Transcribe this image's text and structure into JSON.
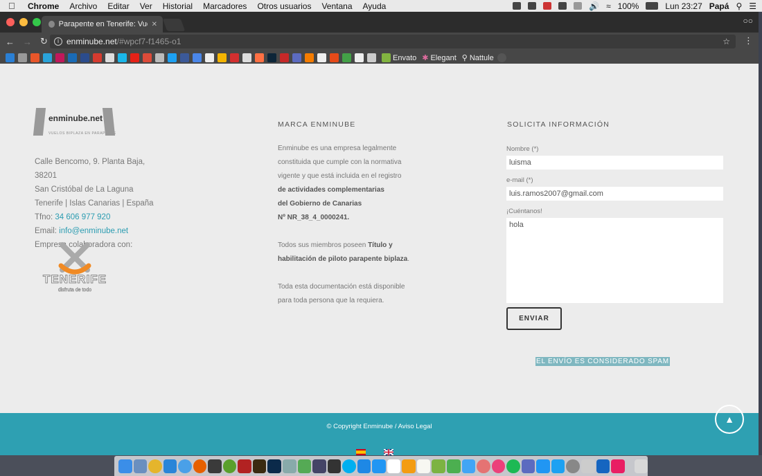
{
  "menubar": {
    "app": "Chrome",
    "items": [
      "Archivo",
      "Editar",
      "Ver",
      "Historial",
      "Marcadores",
      "Otros usuarios",
      "Ventana",
      "Ayuda"
    ],
    "battery": "100%",
    "clock": "Lun 23:27",
    "user": "Papá"
  },
  "browser": {
    "tab_title": "Parapente en Tenerife: Vuelos",
    "url_host": "enminube.net",
    "url_path": "/#wpcf7-f1465-o1",
    "bookmarks": [
      "Envato",
      "Elegant",
      "Nattule"
    ]
  },
  "footer_left": {
    "logo_text": "enminube.net",
    "logo_sub": "VUELOS BIPLAZA EN PARAPENTE",
    "address1": "Calle Bencomo, 9. Planta Baja,",
    "address2": "38201",
    "address3": "San Cristóbal de La Laguna",
    "address4": "Tenerife | Islas Canarias | España",
    "phone_label": "Tfno: ",
    "phone": "34 606 977 920",
    "email_label": "Email: ",
    "email": "info@enminube.net",
    "collab": "Empresa colaboradora con:",
    "tenerife_logo": "TENERIFE",
    "tenerife_sub": "disfruta de todo"
  },
  "footer_mid": {
    "title": "MARCA ENMINUBE",
    "p1_line1": "Enminube es una empresa legalmente",
    "p1_line2": "constituida que cumple con la normativa",
    "p1_line3": "vigente y que está incluida en el registro",
    "p1_bold1": "de actividades complementarias",
    "p1_bold2": "del Gobierno de Canarias",
    "p1_bold3": "Nº NR_38_4_0000241.",
    "p2_line1_pre": "Todos sus miembros poseen ",
    "p2_line1_bold": "Título y",
    "p2_line2_bold": "habilitación de piloto parapente biplaza",
    "p2_line2_post": ".",
    "p3_line1": "Toda esta documentación está disponible",
    "p3_line2": "para toda persona que la requiera."
  },
  "footer_right": {
    "title": "SOLICITA INFORMACIÓN",
    "name_label": "Nombre (*)",
    "name_value": "luisma",
    "email_label": "e-mail (*)",
    "email_value": "luis.ramos2007@gmail.com",
    "message_label": "¡Cuéntanos!",
    "message_value": "hola",
    "send_label": "ENVIAR",
    "spam_message": "EL ENVÍO ES CONSIDERADO SPAM"
  },
  "bottom_bar": {
    "copyright": "© Copyright Enminube / Aviso Legal"
  },
  "colors": {
    "accent": "#2ea0b2",
    "link": "#2b9cb1",
    "page_bg": "#ececec"
  }
}
